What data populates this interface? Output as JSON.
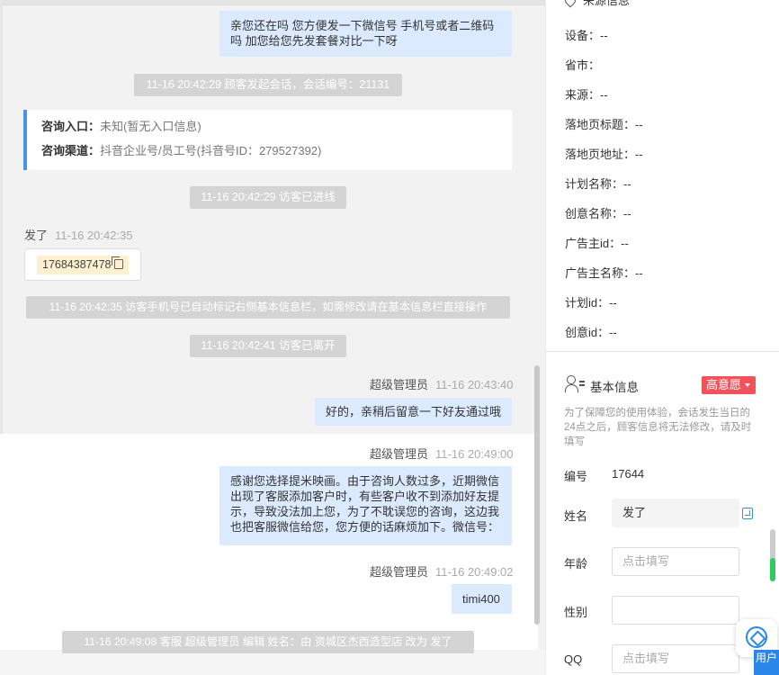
{
  "chat": {
    "msg_top": "亲您还在吗 您方便发一下微信号 手机号或者二维码吗 加您给您先发套餐对比一下呀",
    "sys1": "11-16 20:42:29 顾客发起会话，会话编号：21131",
    "consult_entry_label": "咨询入口：",
    "consult_entry_value": "未知(暂无入口信息)",
    "consult_channel_label": "咨询渠道：",
    "consult_channel_value": "抖音企业号/员工号(抖音号ID：279527392)",
    "sys2": "11-16 20:42:29 访客已进线",
    "visitor_name": "发了",
    "visitor_time": "11-16 20:42:35",
    "phone": "17684387478",
    "sys3": "11-16 20:42:35 访客手机号已自动标记右侧基本信息栏，如需修改请在基本信息栏直接操作",
    "sys4": "11-16 20:42:41 访客已离开",
    "agent1_name": "超级管理员",
    "agent1_time": "11-16 20:43:40",
    "agent1_msg": "好的，亲稍后留意一下好友通过哦",
    "agent2_name": "超级管理员",
    "agent2_time": "11-16 20:49:00",
    "agent2_msg": "感谢您选择提米映画。由于咨询人数过多，近期微信出现了客服添加客户时，有些客户收不到添加好友提示，导致没法加上您，为了不耽误您的咨询，这边我也把客服微信给您，您方便的话麻烦加下。微信号：",
    "agent3_name": "超级管理员",
    "agent3_time": "11-16 20:49:02",
    "agent3_msg": "timi400",
    "sys5": "11-16 20:49:08 客服 超级管理员 编辑 姓名：由 资城区杰西造型店 改为 发了"
  },
  "source": {
    "title": "来源信息",
    "rows": [
      {
        "label": "设备：",
        "value": "--"
      },
      {
        "label": "省市：",
        "value": ""
      },
      {
        "label": "来源：",
        "value": "--"
      },
      {
        "label": "落地页标题：",
        "value": "--"
      },
      {
        "label": "落地页地址：",
        "value": "--"
      },
      {
        "label": "计划名称：",
        "value": "--"
      },
      {
        "label": "创意名称：",
        "value": "--"
      },
      {
        "label": "广告主id：",
        "value": "--"
      },
      {
        "label": "广告主名称：",
        "value": "--"
      },
      {
        "label": "计划id：",
        "value": "--"
      },
      {
        "label": "创意id：",
        "value": "--"
      }
    ]
  },
  "basic": {
    "title": "基本信息",
    "intent": "高意愿",
    "notice": "为了保障您的使用体验，会话发生当日的24点之后，顾客信息将无法修改，请及时填写",
    "id_label": "编号",
    "id_value": "17644",
    "name_label": "姓名",
    "name_value": "发了",
    "age_label": "年龄",
    "age_placeholder": "点击填写",
    "gender_label": "性别",
    "qq_label": "QQ",
    "qq_placeholder": "点击填写"
  },
  "side_tab": "用户",
  "colors": {
    "accent": "#4b8ff0",
    "badge": "#f4525b",
    "bubble": "#dceaff"
  }
}
